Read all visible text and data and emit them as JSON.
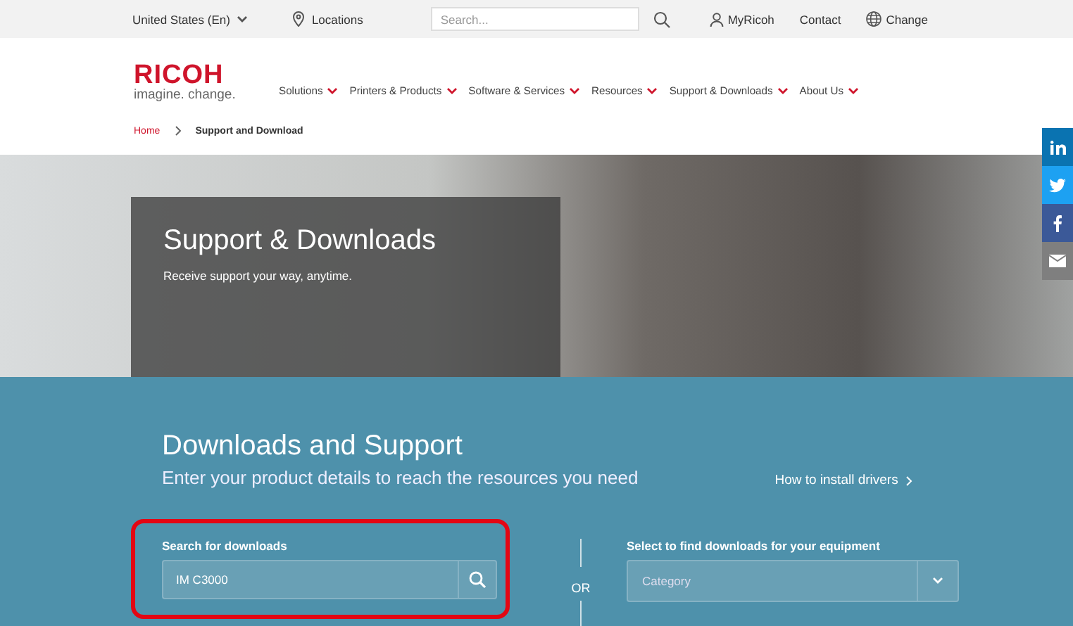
{
  "top_bar": {
    "region": "United States (En)",
    "locations": "Locations",
    "search": {
      "placeholder": "Search..."
    },
    "links": [
      {
        "kind": "user",
        "label": "MyRicoh"
      },
      {
        "kind": "plain",
        "label": "Contact"
      },
      {
        "kind": "globe",
        "label": "Change"
      }
    ]
  },
  "header": {
    "logo": "RICOH",
    "tagline": "imagine. change.",
    "nav": [
      "Solutions",
      "Printers & Products",
      "Software & Services",
      "Resources",
      "Support & Downloads",
      "About Us"
    ]
  },
  "breadcrumb": [
    "Home",
    "Support and Download"
  ],
  "hero": {
    "title": "Support & Downloads",
    "subtitle": "Receive support your way, anytime."
  },
  "share": [
    {
      "kind": "linkedin",
      "color": "#0a73b1"
    },
    {
      "kind": "twitter",
      "color": "#1da1f2"
    },
    {
      "kind": "facebook",
      "color": "#3b5998"
    },
    {
      "kind": "email",
      "color": "#7f7f7f"
    }
  ],
  "support": {
    "title": "Downloads and Support",
    "subtitle": "Enter your product details to reach the resources you need",
    "link": "How to install drivers",
    "search_label": "Search for downloads",
    "search_value": "IM C3000",
    "or": "OR",
    "select_label": "Select to find downloads for your equipment",
    "select_placeholder": "Category",
    "highlighted": true
  }
}
